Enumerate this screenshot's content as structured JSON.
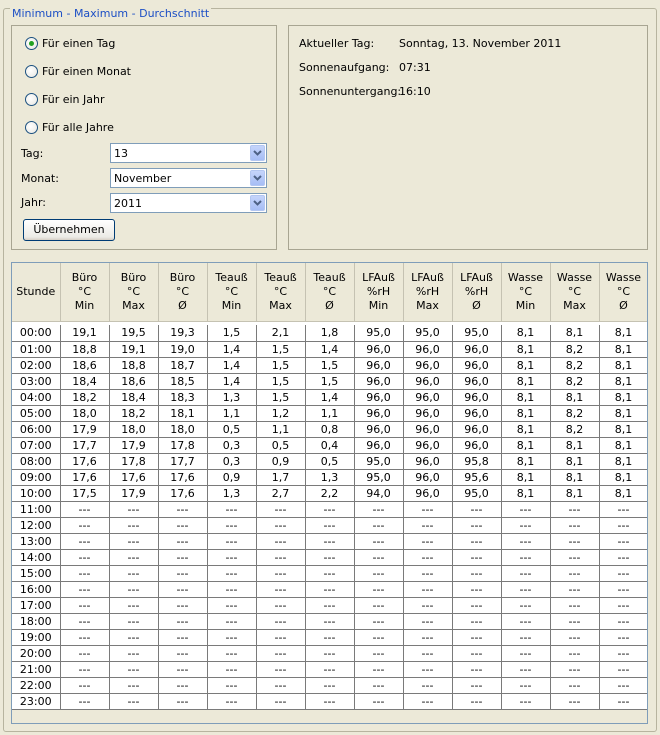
{
  "group_title": "Minimum - Maximum - Durchschnitt",
  "radios": [
    {
      "label": "Für einen Tag",
      "selected": true
    },
    {
      "label": "Für einen Monat",
      "selected": false
    },
    {
      "label": "Für ein Jahr",
      "selected": false
    },
    {
      "label": "Für alle Jahre",
      "selected": false
    }
  ],
  "fields": {
    "day_label": "Tag:",
    "day_value": "13",
    "month_label": "Monat:",
    "month_value": "November",
    "year_label": "Jahr:",
    "year_value": "2011"
  },
  "apply_button": "Übernehmen",
  "info": {
    "current_day_label": "Aktueller Tag:",
    "current_day_value": "Sonntag, 13. November 2011",
    "sunrise_label": "Sonnenaufgang:",
    "sunrise_value": "07:31",
    "sunset_label": "Sonnenuntergang:",
    "sunset_value": "16:10"
  },
  "table": {
    "headers": [
      "Stunde",
      "Büro\n°C\nMin",
      "Büro\n°C\nMax",
      "Büro\n°C\nØ",
      "Teauß\n°C\nMin",
      "Teauß\n°C\nMax",
      "Teauß\n°C\nØ",
      "LFAuß\n%rH\nMin",
      "LFAuß\n%rH\nMax",
      "LFAuß\n%rH\nØ",
      "Wasse\n°C\nMin",
      "Wasse\n°C\nMax",
      "Wasse\n°C\nØ"
    ],
    "rows": [
      [
        "00:00",
        "19,1",
        "19,5",
        "19,3",
        "1,5",
        "2,1",
        "1,8",
        "95,0",
        "95,0",
        "95,0",
        "8,1",
        "8,1",
        "8,1"
      ],
      [
        "01:00",
        "18,8",
        "19,1",
        "19,0",
        "1,4",
        "1,5",
        "1,4",
        "96,0",
        "96,0",
        "96,0",
        "8,1",
        "8,2",
        "8,1"
      ],
      [
        "02:00",
        "18,6",
        "18,8",
        "18,7",
        "1,4",
        "1,5",
        "1,5",
        "96,0",
        "96,0",
        "96,0",
        "8,1",
        "8,2",
        "8,1"
      ],
      [
        "03:00",
        "18,4",
        "18,6",
        "18,5",
        "1,4",
        "1,5",
        "1,5",
        "96,0",
        "96,0",
        "96,0",
        "8,1",
        "8,2",
        "8,1"
      ],
      [
        "04:00",
        "18,2",
        "18,4",
        "18,3",
        "1,3",
        "1,5",
        "1,4",
        "96,0",
        "96,0",
        "96,0",
        "8,1",
        "8,1",
        "8,1"
      ],
      [
        "05:00",
        "18,0",
        "18,2",
        "18,1",
        "1,1",
        "1,2",
        "1,1",
        "96,0",
        "96,0",
        "96,0",
        "8,1",
        "8,2",
        "8,1"
      ],
      [
        "06:00",
        "17,9",
        "18,0",
        "18,0",
        "0,5",
        "1,1",
        "0,8",
        "96,0",
        "96,0",
        "96,0",
        "8,1",
        "8,2",
        "8,1"
      ],
      [
        "07:00",
        "17,7",
        "17,9",
        "17,8",
        "0,3",
        "0,5",
        "0,4",
        "96,0",
        "96,0",
        "96,0",
        "8,1",
        "8,1",
        "8,1"
      ],
      [
        "08:00",
        "17,6",
        "17,8",
        "17,7",
        "0,3",
        "0,9",
        "0,5",
        "95,0",
        "96,0",
        "95,8",
        "8,1",
        "8,1",
        "8,1"
      ],
      [
        "09:00",
        "17,6",
        "17,6",
        "17,6",
        "0,9",
        "1,7",
        "1,3",
        "95,0",
        "96,0",
        "95,6",
        "8,1",
        "8,1",
        "8,1"
      ],
      [
        "10:00",
        "17,5",
        "17,9",
        "17,6",
        "1,3",
        "2,7",
        "2,2",
        "94,0",
        "96,0",
        "95,0",
        "8,1",
        "8,1",
        "8,1"
      ],
      [
        "11:00",
        "---",
        "---",
        "---",
        "---",
        "---",
        "---",
        "---",
        "---",
        "---",
        "---",
        "---",
        "---"
      ],
      [
        "12:00",
        "---",
        "---",
        "---",
        "---",
        "---",
        "---",
        "---",
        "---",
        "---",
        "---",
        "---",
        "---"
      ],
      [
        "13:00",
        "---",
        "---",
        "---",
        "---",
        "---",
        "---",
        "---",
        "---",
        "---",
        "---",
        "---",
        "---"
      ],
      [
        "14:00",
        "---",
        "---",
        "---",
        "---",
        "---",
        "---",
        "---",
        "---",
        "---",
        "---",
        "---",
        "---"
      ],
      [
        "15:00",
        "---",
        "---",
        "---",
        "---",
        "---",
        "---",
        "---",
        "---",
        "---",
        "---",
        "---",
        "---"
      ],
      [
        "16:00",
        "---",
        "---",
        "---",
        "---",
        "---",
        "---",
        "---",
        "---",
        "---",
        "---",
        "---",
        "---"
      ],
      [
        "17:00",
        "---",
        "---",
        "---",
        "---",
        "---",
        "---",
        "---",
        "---",
        "---",
        "---",
        "---",
        "---"
      ],
      [
        "18:00",
        "---",
        "---",
        "---",
        "---",
        "---",
        "---",
        "---",
        "---",
        "---",
        "---",
        "---",
        "---"
      ],
      [
        "19:00",
        "---",
        "---",
        "---",
        "---",
        "---",
        "---",
        "---",
        "---",
        "---",
        "---",
        "---",
        "---"
      ],
      [
        "20:00",
        "---",
        "---",
        "---",
        "---",
        "---",
        "---",
        "---",
        "---",
        "---",
        "---",
        "---",
        "---"
      ],
      [
        "21:00",
        "---",
        "---",
        "---",
        "---",
        "---",
        "---",
        "---",
        "---",
        "---",
        "---",
        "---",
        "---"
      ],
      [
        "22:00",
        "---",
        "---",
        "---",
        "---",
        "---",
        "---",
        "---",
        "---",
        "---",
        "---",
        "---",
        "---"
      ],
      [
        "23:00",
        "---",
        "---",
        "---",
        "---",
        "---",
        "---",
        "---",
        "---",
        "---",
        "---",
        "---",
        "---"
      ]
    ]
  }
}
